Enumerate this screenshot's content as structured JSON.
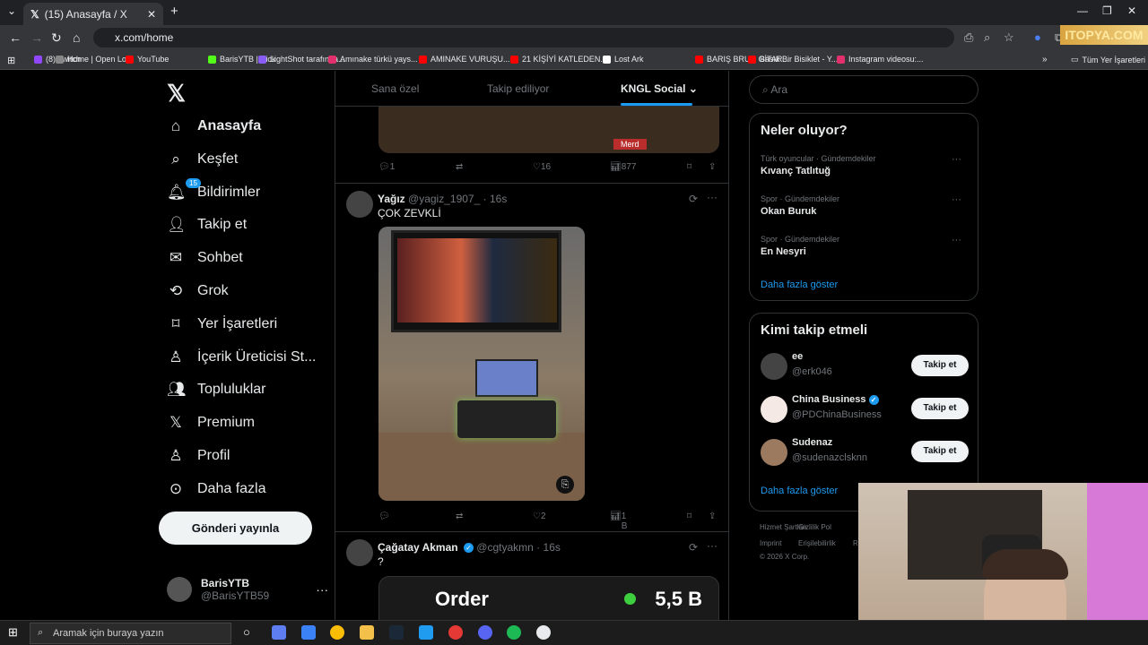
{
  "browser": {
    "tab_title": "(15) Anasayfa / X",
    "url": "x.com/home",
    "bookmarks": [
      {
        "label": "(8) Twitch",
        "color": "#9146ff"
      },
      {
        "label": "Home | Open Loot",
        "color": "#888888"
      },
      {
        "label": "YouTube",
        "color": "#ff0000"
      },
      {
        "label": "BarisYTB | Kick",
        "color": "#53fc18"
      },
      {
        "label": "LightShot tarafında...",
        "color": "#8a5cf6"
      },
      {
        "label": "Amınake türkü yays...",
        "color": "#e1306c"
      },
      {
        "label": "AMINAKE VURUŞU...",
        "color": "#ff0000"
      },
      {
        "label": "21 KİŞİYİ KATLEDEN...",
        "color": "#ff0000"
      },
      {
        "label": "Lost Ark",
        "color": "#ffffff"
      },
      {
        "label": "BARIŞ BRUH GİTAR...",
        "color": "#ff0000"
      },
      {
        "label": "Basık Bir Bisiklet - Y...",
        "color": "#ff0000"
      },
      {
        "label": "Instagram videosu:...",
        "color": "#e1306c"
      }
    ],
    "all_bookmarks": "Tüm Yer İşaretleri"
  },
  "sidebar": {
    "items": [
      {
        "label": "Anasayfa",
        "icon": "home-icon"
      },
      {
        "label": "Keşfet",
        "icon": "search-icon"
      },
      {
        "label": "Bildirimler",
        "icon": "bell-icon",
        "badge": "15"
      },
      {
        "label": "Takip et",
        "icon": "follow-icon"
      },
      {
        "label": "Sohbet",
        "icon": "mail-icon"
      },
      {
        "label": "Grok",
        "icon": "grok-icon"
      },
      {
        "label": "Yer İşaretleri",
        "icon": "bookmark-icon"
      },
      {
        "label": "İçerik Üreticisi St...",
        "icon": "creator-icon"
      },
      {
        "label": "Topluluklar",
        "icon": "communities-icon"
      },
      {
        "label": "Premium",
        "icon": "x-premium-icon"
      },
      {
        "label": "Profil",
        "icon": "profile-icon"
      },
      {
        "label": "Daha fazla",
        "icon": "more-icon"
      }
    ],
    "post_button": "Gönderi yayınla",
    "account": {
      "name": "BarisYTB",
      "handle": "@BarisYTB59"
    }
  },
  "feed": {
    "tabs": [
      "Sana özel",
      "Takip ediliyor",
      "KNGL Social"
    ],
    "prev_post": {
      "tag": "Merd",
      "replies": "1",
      "likes": "16",
      "views": "877"
    },
    "post1": {
      "name": "Yağız",
      "handle": "@yagiz_1907_",
      "time": "16s",
      "text": "ÇOK ZEVKLİ",
      "likes": "2",
      "views": "1 B"
    },
    "post2": {
      "name": "Çağatay Akman",
      "handle": "@cgtyakmn",
      "time": "16s",
      "text": "?",
      "card_title": "Order",
      "card_value": "5,5 B"
    }
  },
  "right": {
    "search_placeholder": "Ara",
    "trends_title": "Neler oluyor?",
    "trends": [
      {
        "context": "Türk oyuncular · Gündemdekiler",
        "name": "Kıvanç Tatlıtuğ"
      },
      {
        "context": "Spor · Gündemdekiler",
        "name": "Okan Buruk"
      },
      {
        "context": "Spor · Gündemdekiler",
        "name": "En Nesyri"
      }
    ],
    "show_more": "Daha fazla göster",
    "who_title": "Kimi takip etmeli",
    "who": [
      {
        "name": "ee",
        "handle": "@erk046",
        "verified": false
      },
      {
        "name": "China Business",
        "handle": "@PDChinaBusiness",
        "verified": true
      },
      {
        "name": "Sudenaz",
        "handle": "@sudenazclsknn",
        "verified": false
      }
    ],
    "follow_label": "Takip et",
    "footer": [
      "Hizmet Şartları",
      "Gizlilik Pol",
      "Imprint",
      "Erişilebilirlik",
      "R",
      "© 2026 X Corp."
    ]
  },
  "watermark": "ITOPYA.COM",
  "taskbar": {
    "search_placeholder": "Aramak için buraya yazın"
  }
}
